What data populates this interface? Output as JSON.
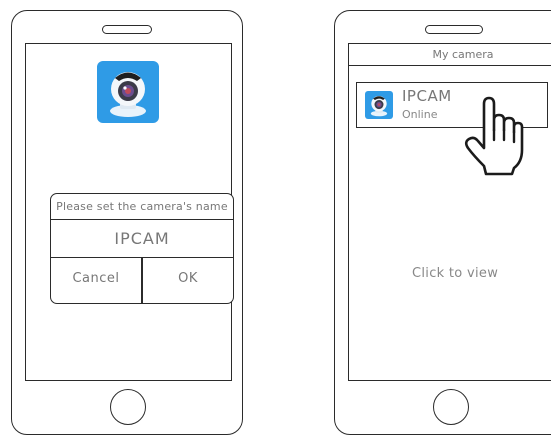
{
  "left_phone": {
    "dialog": {
      "title": "Please set the camera's name",
      "name_value": "IPCAM",
      "cancel_label": "Cancel",
      "ok_label": "OK"
    }
  },
  "right_phone": {
    "header_title": "My camera",
    "camera_item": {
      "name": "IPCAM",
      "status": "Online"
    },
    "hint": "Click to view"
  },
  "colors": {
    "icon_blue": "#2f9be6",
    "outline": "#2b2b2b",
    "text": "#777777"
  },
  "icons": [
    "camera-app-icon",
    "pointing-hand-icon"
  ]
}
